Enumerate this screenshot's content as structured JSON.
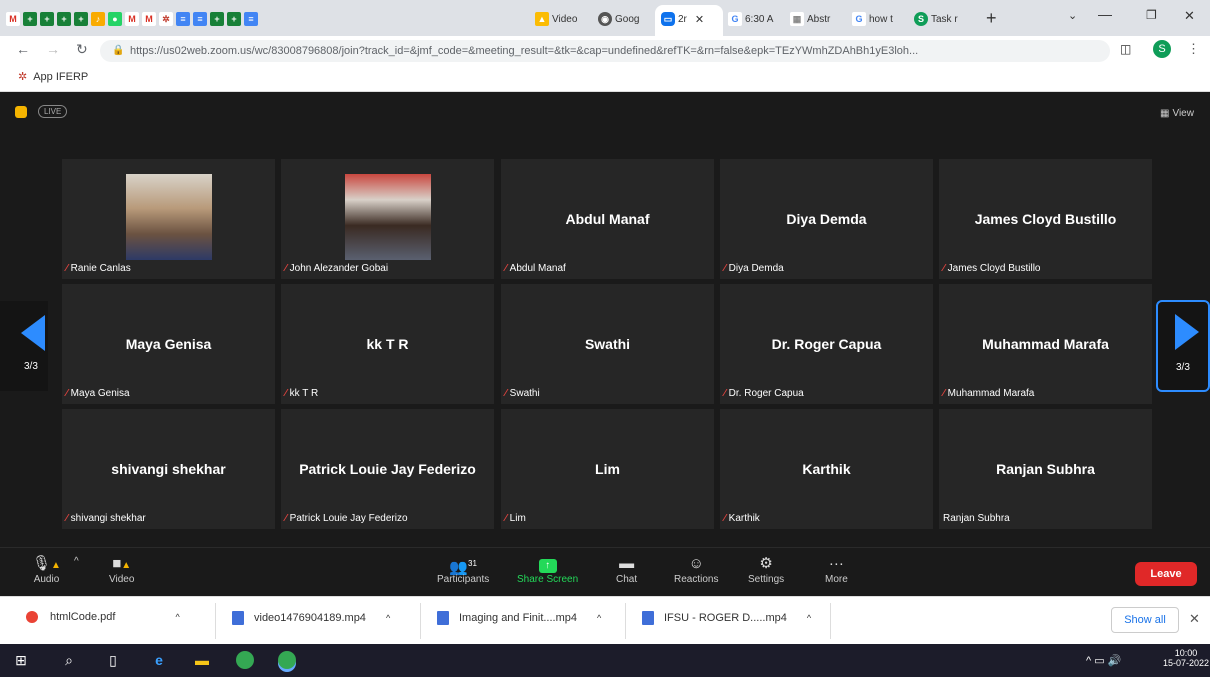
{
  "browser": {
    "tabs": [
      "Video",
      "Goog",
      "2r",
      "6:30 A",
      "Abstr",
      "how t",
      "Task r"
    ],
    "url": "https://us02web.zoom.us/wc/83008796808/join?track_id=&jmf_code=&meeting_result=&tk=&cap=undefined&refTK=&rn=false&epk=TEzYWmhZDAhBh1yE3loh...",
    "bookmark": "App IFERP",
    "profile_initial": "S"
  },
  "zoom": {
    "live_badge": "LIVE",
    "view_label": "View",
    "page_left": "3/3",
    "page_right": "3/3",
    "tiles": [
      {
        "big": "",
        "name": "Ranie Canlas",
        "photo": true
      },
      {
        "big": "",
        "name": "John Alezander Gobai",
        "photo": true
      },
      {
        "big": "Abdul Manaf",
        "name": "Abdul Manaf"
      },
      {
        "big": "Diya Demda",
        "name": "Diya Demda"
      },
      {
        "big": "James Cloyd Bustillo",
        "name": "James Cloyd Bustillo"
      },
      {
        "big": "Maya Genisa",
        "name": "Maya Genisa"
      },
      {
        "big": "kk T R",
        "name": "kk T R"
      },
      {
        "big": "Swathi",
        "name": "Swathi"
      },
      {
        "big": "Dr. Roger Capua",
        "name": "Dr. Roger Capua"
      },
      {
        "big": "Muhammad Marafa",
        "name": "Muhammad Marafa"
      },
      {
        "big": "shivangi shekhar",
        "name": "shivangi shekhar"
      },
      {
        "big": "Patrick Louie Jay Federizo",
        "name": "Patrick Louie Jay Federizo"
      },
      {
        "big": "Lim",
        "name": "Lim"
      },
      {
        "big": "Karthik",
        "name": "Karthik"
      },
      {
        "big": "Ranjan Subhra",
        "name": "Ranjan Subhra",
        "unmuted": true
      }
    ],
    "toolbar": {
      "audio": "Audio",
      "video": "Video",
      "participants": "Participants",
      "participant_count": "31",
      "share": "Share Screen",
      "chat": "Chat",
      "reactions": "Reactions",
      "settings": "Settings",
      "more": "More",
      "leave": "Leave"
    }
  },
  "downloads": {
    "items": [
      "htmlCode.pdf",
      "video1476904189.mp4",
      "Imaging and Finit....mp4",
      "IFSU - ROGER D.....mp4"
    ],
    "show_all": "Show all"
  },
  "taskbar": {
    "time": "10:00",
    "date": "15-07-2022"
  },
  "colors": {
    "accent": "#0e72ed",
    "leave": "#e02828",
    "share": "#23d959"
  }
}
